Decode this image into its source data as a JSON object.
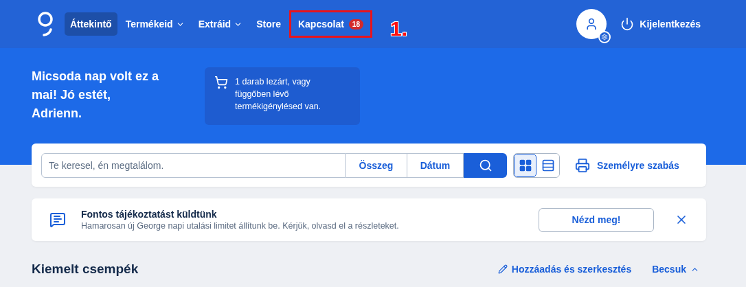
{
  "nav": {
    "items": [
      {
        "label": "Áttekintő",
        "selected": true,
        "dropdown": false
      },
      {
        "label": "Termékeid",
        "selected": false,
        "dropdown": true
      },
      {
        "label": "Extráid",
        "selected": false,
        "dropdown": true
      },
      {
        "label": "Store",
        "selected": false,
        "dropdown": false
      },
      {
        "label": "Kapcsolat",
        "selected": false,
        "dropdown": false,
        "badge": "18",
        "annotated": true
      }
    ],
    "annotation": "1.",
    "logout": "Kijelentkezés"
  },
  "greeting": "Micsoda nap volt ez a mai! Jó estét, Adrienn.",
  "info_card": "1 darab lezárt, vagy függőben lévő termékigénylésed van.",
  "search": {
    "placeholder": "Te keresel, én megtalálom.",
    "filters": [
      "Összeg",
      "Dátum"
    ],
    "views": [
      {
        "kind": "grid",
        "selected": true
      },
      {
        "kind": "list",
        "selected": false
      }
    ],
    "customize": "Személyre szabás"
  },
  "notice": {
    "title": "Fontos tájékoztatást küldtünk",
    "text": "Hamarosan új George napi utalási limitet állítunk be. Kérjük, olvasd el a részleteket.",
    "button": "Nézd meg!"
  },
  "section": {
    "title": "Kiemelt csempék",
    "edit": "Hozzáadás és szerkesztés",
    "collapse": "Becsuk"
  }
}
